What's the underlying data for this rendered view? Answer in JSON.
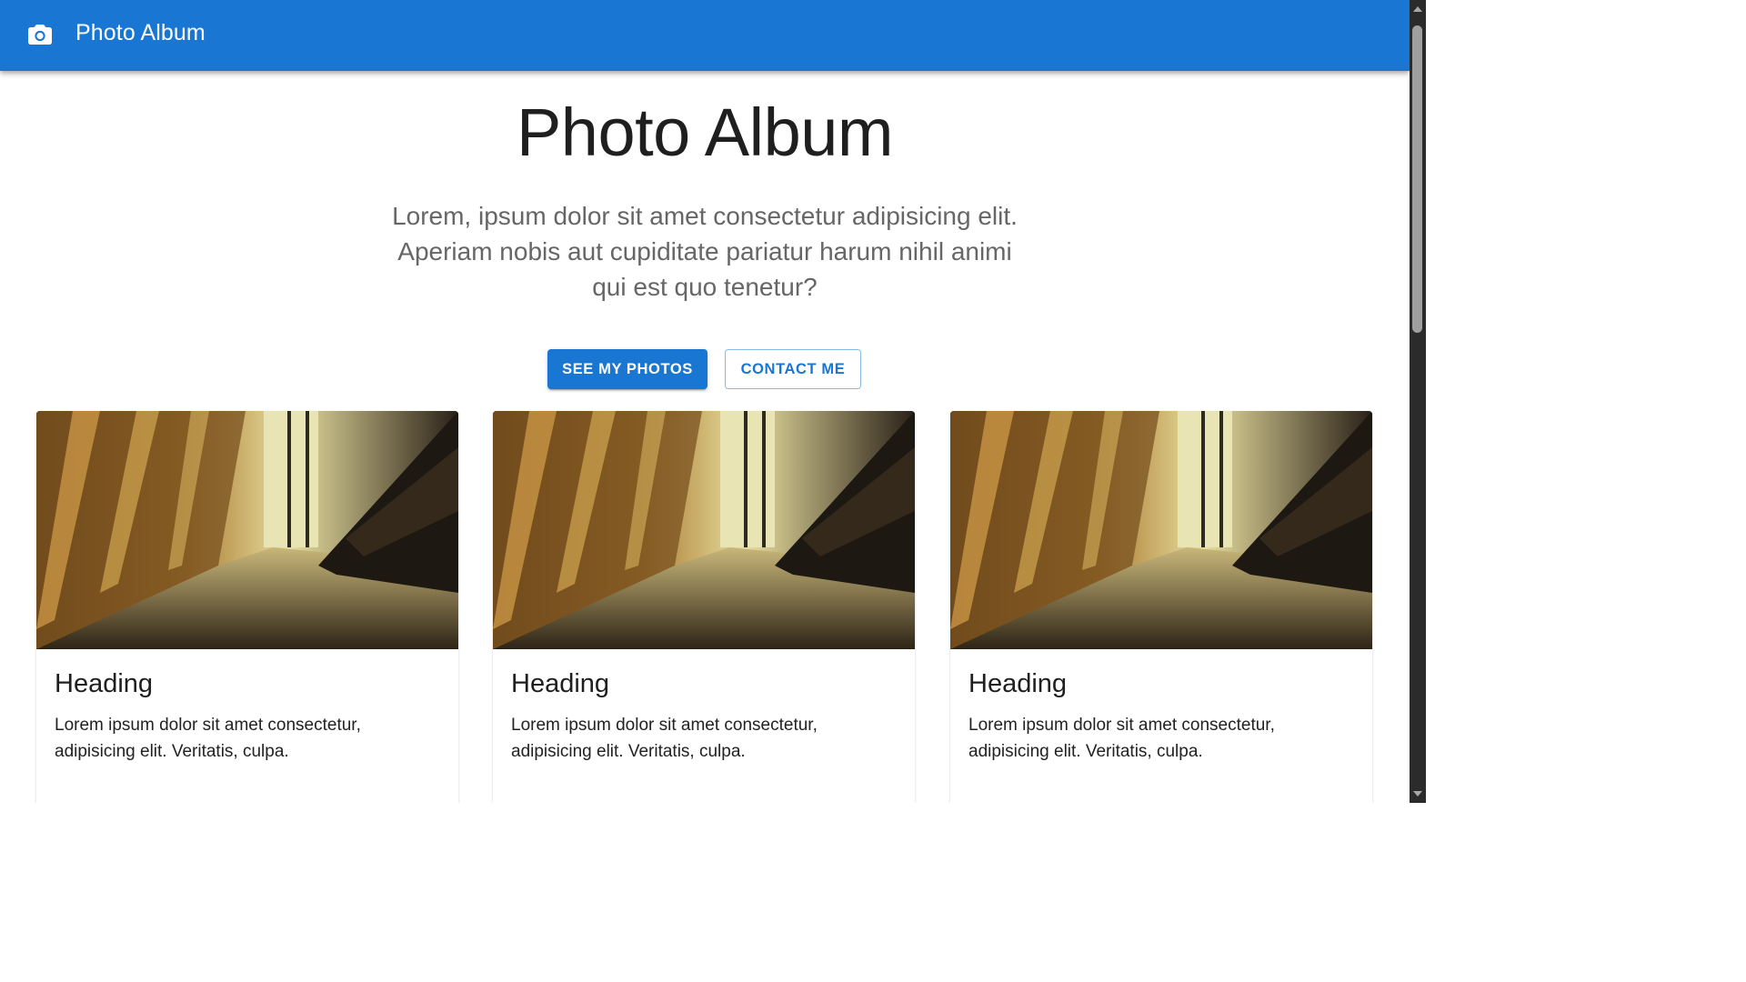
{
  "appbar": {
    "icon": "camera-icon",
    "title": "Photo Album",
    "color": "#1976d2"
  },
  "hero": {
    "title": "Photo Album",
    "subtitle": "Lorem, ipsum dolor sit amet consectetur adipisicing elit. Aperiam nobis aut cupiditate pariatur harum nihil animi qui est quo tenetur?",
    "primary_button": "See my photos",
    "secondary_button": "Contact me"
  },
  "cards": [
    {
      "image": "auditorium-seats-photo",
      "heading": "Heading",
      "text": "Lorem ipsum dolor sit amet consectetur, adipisicing elit. Veritatis, culpa."
    },
    {
      "image": "auditorium-seats-photo",
      "heading": "Heading",
      "text": "Lorem ipsum dolor sit amet consectetur, adipisicing elit. Veritatis, culpa."
    },
    {
      "image": "auditorium-seats-photo",
      "heading": "Heading",
      "text": "Lorem ipsum dolor sit amet consectetur, adipisicing elit. Veritatis, culpa."
    }
  ]
}
